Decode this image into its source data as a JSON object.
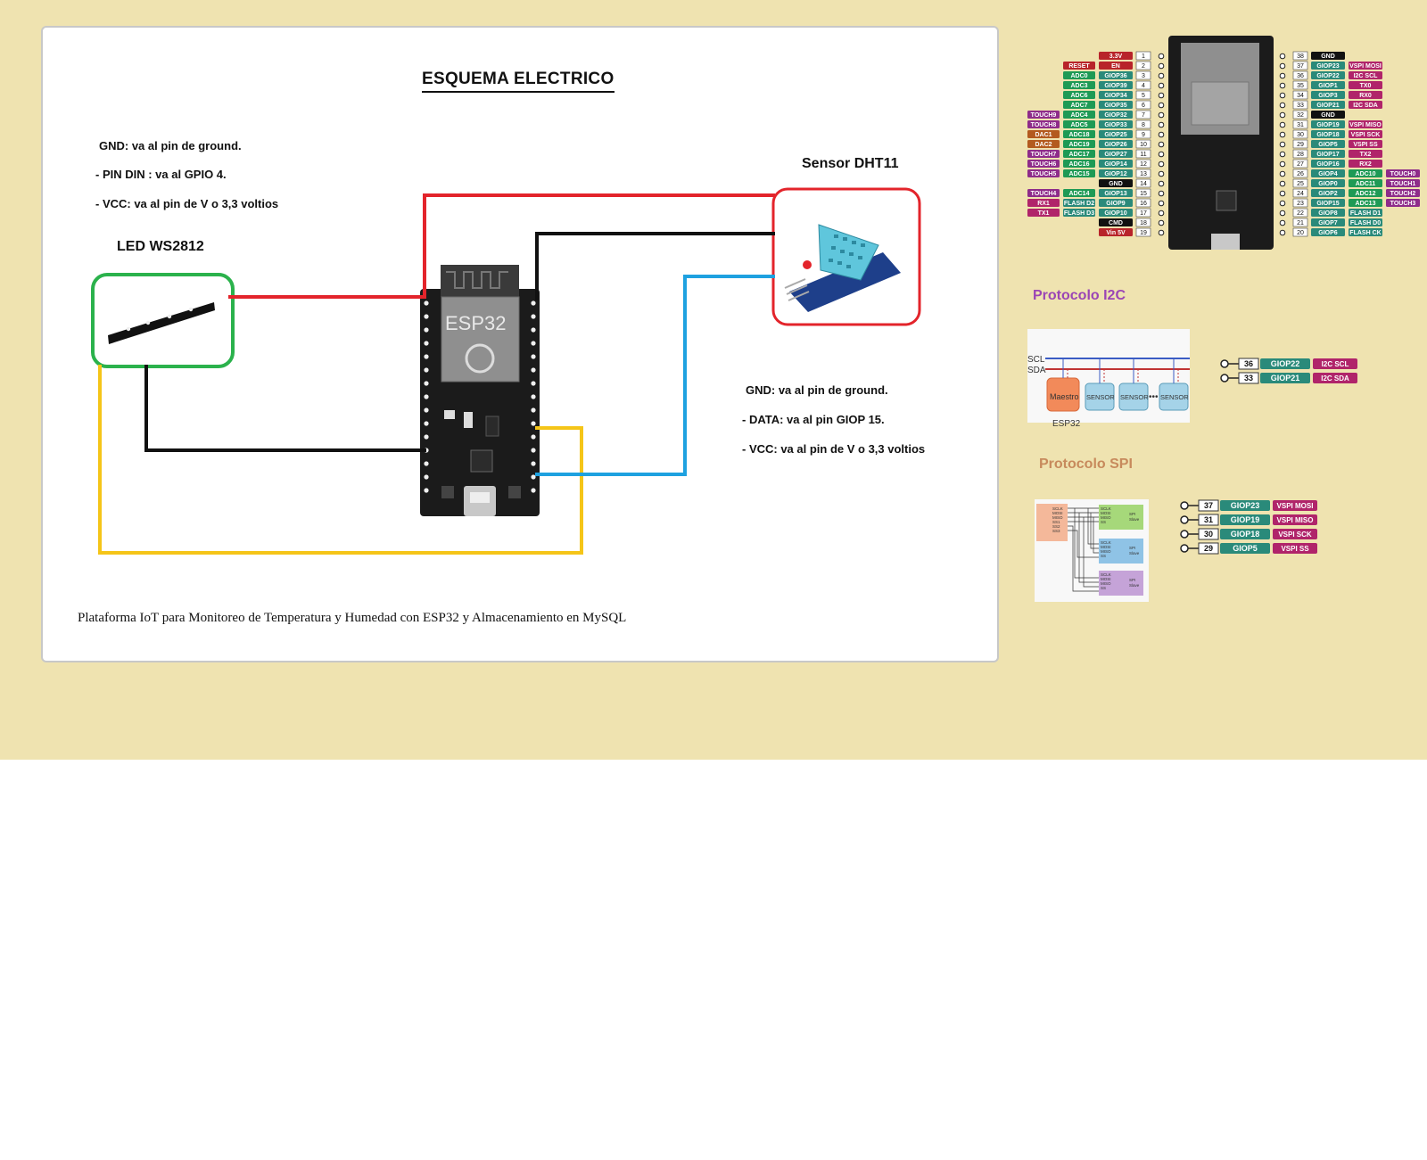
{
  "colors": {
    "page_bg": "#efe3b0",
    "wire_vcc": "#e3242b",
    "wire_gnd": "#111111",
    "wire_din": "#f5c518",
    "wire_data": "#1ea1e0",
    "led_box": "#2bb24c",
    "sensor_box": "#e3242b"
  },
  "schematic": {
    "title": "ESQUEMA ELECTRICO",
    "led_notes": [
      "GND: va al pin de ground.",
      "- PIN DIN : va al GPIO 4.",
      "- VCC: va al pin de V o 3,3 voltios"
    ],
    "led_label": "LED WS2812",
    "sensor_label": "Sensor DHT11",
    "sensor_notes": [
      "GND: va al pin de ground.",
      "- DATA: va al pin GIOP 15.",
      "- VCC: va al pin de V o 3,3 voltios"
    ],
    "board_label": "ESP32",
    "footer": "Plataforma IoT para Monitoreo de Temperatura y Humedad con ESP32 y Almacenamiento en MySQL"
  },
  "pinout": {
    "left_pins": [
      {
        "num": "1",
        "gpio": "3.3V",
        "extra": []
      },
      {
        "num": "2",
        "gpio": "EN",
        "extra": [
          "RESET"
        ]
      },
      {
        "num": "3",
        "gpio": "GIOP36",
        "extra": [
          "ADC0"
        ]
      },
      {
        "num": "4",
        "gpio": "GIOP39",
        "extra": [
          "ADC3"
        ]
      },
      {
        "num": "5",
        "gpio": "GIOP34",
        "extra": [
          "ADC6"
        ]
      },
      {
        "num": "6",
        "gpio": "GIOP35",
        "extra": [
          "ADC7"
        ]
      },
      {
        "num": "7",
        "gpio": "GIOP32",
        "extra": [
          "ADC4",
          "TOUCH9"
        ]
      },
      {
        "num": "8",
        "gpio": "GIOP33",
        "extra": [
          "ADC5",
          "TOUCH8"
        ]
      },
      {
        "num": "9",
        "gpio": "GIOP25",
        "extra": [
          "ADC18",
          "DAC1"
        ]
      },
      {
        "num": "10",
        "gpio": "GIOP26",
        "extra": [
          "ADC19",
          "DAC2"
        ]
      },
      {
        "num": "11",
        "gpio": "GIOP27",
        "extra": [
          "ADC17",
          "TOUCH7"
        ]
      },
      {
        "num": "12",
        "gpio": "GIOP14",
        "extra": [
          "ADC16",
          "TOUCH6"
        ]
      },
      {
        "num": "13",
        "gpio": "GIOP12",
        "extra": [
          "ADC15",
          "TOUCH5"
        ]
      },
      {
        "num": "14",
        "gpio": "GND",
        "extra": []
      },
      {
        "num": "15",
        "gpio": "GIOP13",
        "extra": [
          "ADC14",
          "TOUCH4"
        ]
      },
      {
        "num": "16",
        "gpio": "GIOP9",
        "extra": [
          "FLASH D2",
          "RX1"
        ]
      },
      {
        "num": "17",
        "gpio": "GIOP10",
        "extra": [
          "FLASH D3",
          "TX1"
        ]
      },
      {
        "num": "18",
        "gpio": "CMD",
        "extra": []
      },
      {
        "num": "19",
        "gpio": "Vin 5V",
        "extra": []
      }
    ],
    "right_pins": [
      {
        "num": "38",
        "gpio": "GND",
        "extra": []
      },
      {
        "num": "37",
        "gpio": "GIOP23",
        "extra": [
          "VSPI MOSI"
        ]
      },
      {
        "num": "36",
        "gpio": "GIOP22",
        "extra": [
          "I2C SCL"
        ]
      },
      {
        "num": "35",
        "gpio": "GIOP1",
        "extra": [
          "TX0"
        ]
      },
      {
        "num": "34",
        "gpio": "GIOP3",
        "extra": [
          "RX0"
        ]
      },
      {
        "num": "33",
        "gpio": "GIOP21",
        "extra": [
          "I2C SDA"
        ]
      },
      {
        "num": "32",
        "gpio": "GND",
        "extra": []
      },
      {
        "num": "31",
        "gpio": "GIOP19",
        "extra": [
          "VSPI MISO"
        ]
      },
      {
        "num": "30",
        "gpio": "GIOP18",
        "extra": [
          "VSPI SCK"
        ]
      },
      {
        "num": "29",
        "gpio": "GIOP5",
        "extra": [
          "VSPI SS"
        ]
      },
      {
        "num": "28",
        "gpio": "GIOP17",
        "extra": [
          "TX2"
        ]
      },
      {
        "num": "27",
        "gpio": "GIOP16",
        "extra": [
          "RX2"
        ]
      },
      {
        "num": "26",
        "gpio": "GIOP4",
        "extra": [
          "ADC10",
          "TOUCH0"
        ]
      },
      {
        "num": "25",
        "gpio": "GIOP0",
        "extra": [
          "ADC11",
          "TOUCH1"
        ]
      },
      {
        "num": "24",
        "gpio": "GIOP2",
        "extra": [
          "ADC12",
          "TOUCH2"
        ]
      },
      {
        "num": "23",
        "gpio": "GIOP15",
        "extra": [
          "ADC13",
          "TOUCH3"
        ]
      },
      {
        "num": "22",
        "gpio": "GIOP8",
        "extra": [
          "FLASH D1"
        ]
      },
      {
        "num": "21",
        "gpio": "GIOP7",
        "extra": [
          "FLASH D0"
        ]
      },
      {
        "num": "20",
        "gpio": "GIOP6",
        "extra": [
          "FLASH CK"
        ]
      }
    ]
  },
  "i2c": {
    "title": "Protocolo I2C",
    "bus_lines": [
      "SCL",
      "SDA"
    ],
    "master": "Maestro",
    "master_sub": "ESP32",
    "devices": [
      "SENSOR",
      "SENSOR",
      "SENSOR"
    ],
    "pins": [
      {
        "num": "36",
        "gpio": "GIOP22",
        "func": "I2C SCL"
      },
      {
        "num": "33",
        "gpio": "GIOP21",
        "func": "I2C SDA"
      }
    ]
  },
  "spi": {
    "title": "Protocolo SPI",
    "master_signals": [
      "SCLK",
      "MOSI",
      "MISO",
      "SS1",
      "SS2",
      "SS3"
    ],
    "slave_signals": [
      "SCLK",
      "MOSI",
      "MISO",
      "SS"
    ],
    "slave_label": [
      "SPI",
      "Slave"
    ],
    "pins": [
      {
        "num": "37",
        "gpio": "GIOP23",
        "func": "VSPI MOSI"
      },
      {
        "num": "31",
        "gpio": "GIOP19",
        "func": "VSPI MISO"
      },
      {
        "num": "30",
        "gpio": "GIOP18",
        "func": "VSPI SCK"
      },
      {
        "num": "29",
        "gpio": "GIOP5",
        "func": "VSPI SS"
      }
    ]
  }
}
